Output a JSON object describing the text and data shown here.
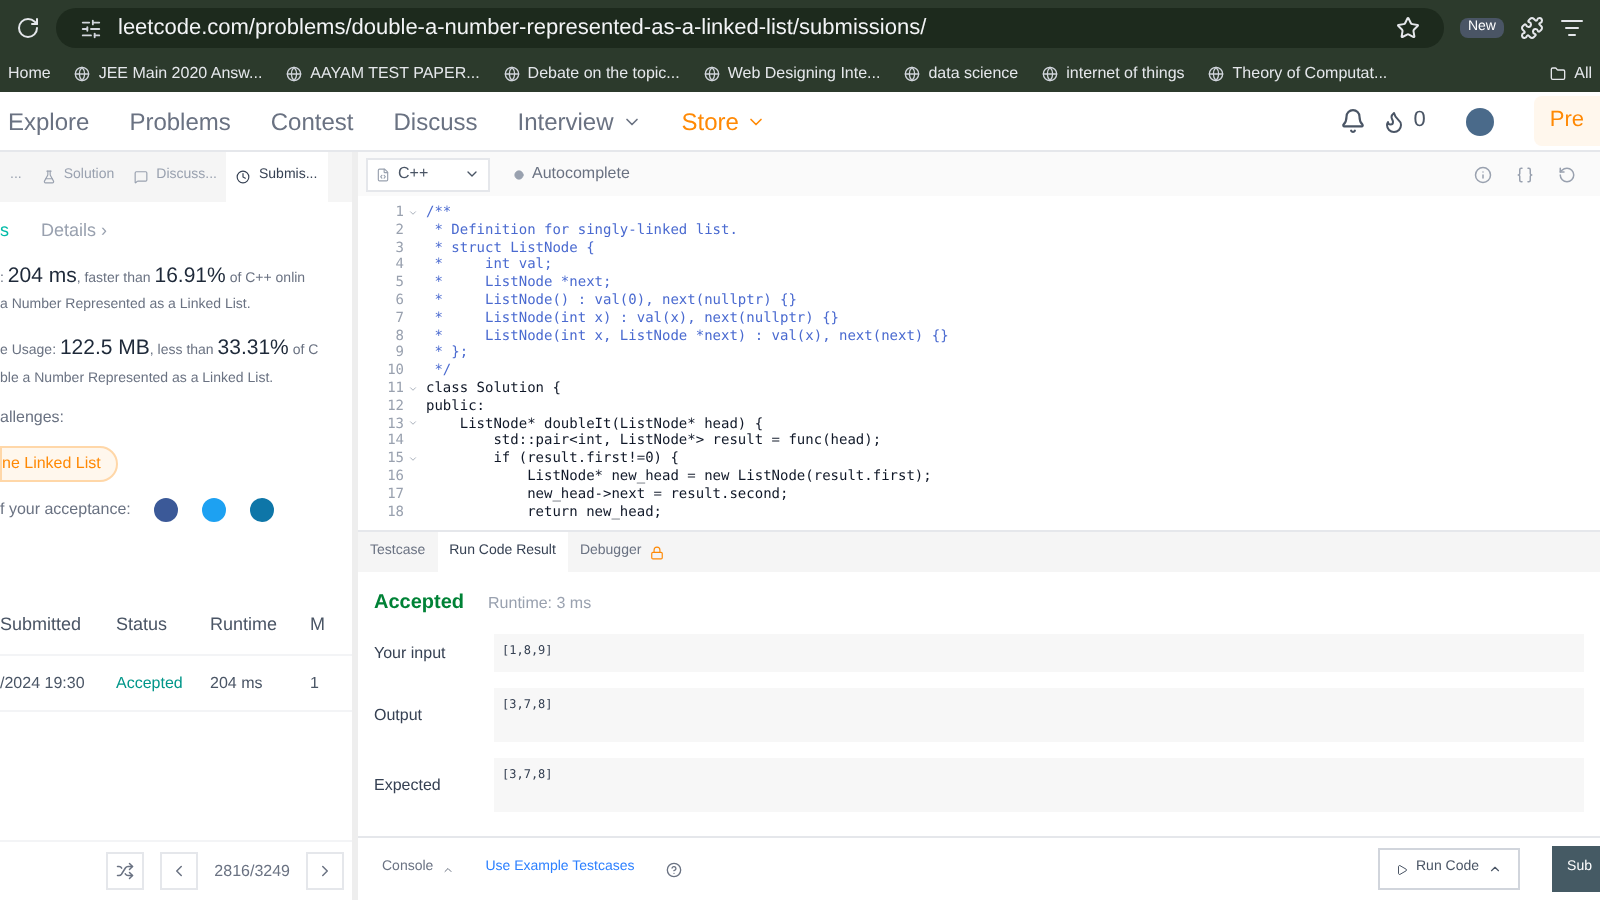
{
  "browser": {
    "url": "leetcode.com/problems/double-a-number-represented-as-a-linked-list/submissions/",
    "new_badge": "New",
    "bookmarks": [
      "Home",
      "JEE Main 2020 Answ...",
      "AAYAM TEST PAPER...",
      "Debate on the topic...",
      "Web Designing Inte...",
      "data science",
      "internet of things",
      "Theory of Computat..."
    ],
    "all_bookmarks": "All"
  },
  "nav": {
    "items": [
      {
        "label": "Explore",
        "kind": "plain"
      },
      {
        "label": "Problems",
        "kind": "plain"
      },
      {
        "label": "Contest",
        "kind": "plain"
      },
      {
        "label": "Discuss",
        "kind": "plain"
      },
      {
        "label": "Interview",
        "kind": "dropdown"
      },
      {
        "label": "Store",
        "kind": "store"
      }
    ],
    "streak": "0",
    "premium": "Pre"
  },
  "left": {
    "tabs": [
      {
        "label": "...",
        "selected": false
      },
      {
        "label": "Solution",
        "selected": false
      },
      {
        "label": "Discuss...",
        "selected": false
      },
      {
        "label": "Submis...",
        "selected": true
      }
    ],
    "status": "s",
    "details": "Details ›",
    "runtime": {
      "pre": ": ",
      "value": "204 ms",
      "mid": ", faster than ",
      "pct": "16.91%",
      "post": " of C++ onlin",
      "sub": "a Number Represented as a Linked List."
    },
    "memory": {
      "pre": "e Usage: ",
      "value": "122.5 MB",
      "mid": ", less than ",
      "pct": "33.31%",
      "post": " of C",
      "sub": "ble a Number Represented as a Linked List."
    },
    "challenges": "allenges:",
    "challenge_tag": "ne Linked List",
    "share": "f your acceptance:",
    "table": {
      "columns": [
        "Submitted",
        "Status",
        "Runtime",
        "M"
      ],
      "rows": [
        [
          "/2024 19:30",
          "Accepted",
          "204 ms",
          "1"
        ]
      ]
    },
    "pager": "2816/3249"
  },
  "editor": {
    "language": "C++",
    "autocomplete": "Autocomplete",
    "lines": [
      {
        "n": "1",
        "fold": true,
        "kind": "comment",
        "text": "/**"
      },
      {
        "n": "2",
        "fold": false,
        "kind": "comment",
        "text": " * Definition for singly-linked list."
      },
      {
        "n": "3",
        "fold": false,
        "kind": "comment",
        "text": " * struct ListNode {"
      },
      {
        "n": "4",
        "fold": false,
        "kind": "comment",
        "text": " *     int val;"
      },
      {
        "n": "5",
        "fold": false,
        "kind": "comment",
        "text": " *     ListNode *next;"
      },
      {
        "n": "6",
        "fold": false,
        "kind": "comment",
        "text": " *     ListNode() : val(0), next(nullptr) {}"
      },
      {
        "n": "7",
        "fold": false,
        "kind": "comment",
        "text": " *     ListNode(int x) : val(x), next(nullptr) {}"
      },
      {
        "n": "8",
        "fold": false,
        "kind": "comment",
        "text": " *     ListNode(int x, ListNode *next) : val(x), next(next) {}"
      },
      {
        "n": "9",
        "fold": false,
        "kind": "comment",
        "text": " * };"
      },
      {
        "n": "10",
        "fold": false,
        "kind": "comment",
        "text": " */"
      },
      {
        "n": "11",
        "fold": true,
        "kind": "code",
        "text": "class Solution {"
      },
      {
        "n": "12",
        "fold": false,
        "kind": "code",
        "text": "public:"
      },
      {
        "n": "13",
        "fold": true,
        "kind": "code",
        "text": "    ListNode* doubleIt(ListNode* head) {"
      },
      {
        "n": "14",
        "fold": false,
        "kind": "code",
        "text": "        std::pair<int, ListNode*> result = func(head);"
      },
      {
        "n": "15",
        "fold": true,
        "kind": "code",
        "text": "        if (result.first!=0) {"
      },
      {
        "n": "16",
        "fold": false,
        "kind": "code",
        "text": "            ListNode* new_head = new ListNode(result.first);"
      },
      {
        "n": "17",
        "fold": false,
        "kind": "code",
        "text": "            new_head->next = result.second;"
      },
      {
        "n": "18",
        "fold": false,
        "kind": "code",
        "text": "            return new_head;"
      }
    ]
  },
  "console": {
    "tabs": [
      {
        "label": "Testcase",
        "selected": false
      },
      {
        "label": "Run Code Result",
        "selected": true
      },
      {
        "label": "Debugger",
        "selected": false
      }
    ],
    "result": "Accepted",
    "runtime": "Runtime: 3 ms",
    "fields": [
      {
        "label": "Your input",
        "value": "[1,8,9]"
      },
      {
        "label": "Output",
        "value": "[3,7,8]"
      },
      {
        "label": "Expected",
        "value": "[3,7,8]"
      }
    ],
    "console_button": "Console",
    "example": "Use Example Testcases",
    "run": "Run Code",
    "submit": "Sub"
  }
}
